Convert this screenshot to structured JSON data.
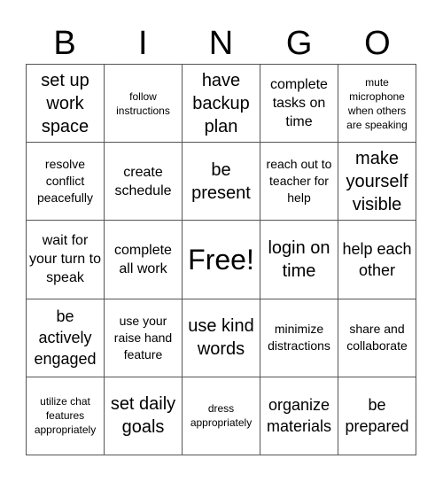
{
  "header": {
    "letters": [
      "B",
      "I",
      "N",
      "G",
      "O"
    ]
  },
  "card": {
    "rows": [
      [
        {
          "text": "set up work space",
          "size": "xl"
        },
        {
          "text": "follow instructions",
          "size": "xs"
        },
        {
          "text": "have backup plan",
          "size": "xl"
        },
        {
          "text": "complete tasks on time",
          "size": "md"
        },
        {
          "text": "mute microphone when others are speaking",
          "size": "xs"
        }
      ],
      [
        {
          "text": "resolve conflict peacefully",
          "size": "sm"
        },
        {
          "text": "create schedule",
          "size": "md"
        },
        {
          "text": "be present",
          "size": "xl"
        },
        {
          "text": "reach out to teacher for help",
          "size": "sm"
        },
        {
          "text": "make yourself visible",
          "size": "xl"
        }
      ],
      [
        {
          "text": "wait for your turn to speak",
          "size": "md"
        },
        {
          "text": "complete all work",
          "size": "md"
        },
        {
          "text": "Free!",
          "size": "free"
        },
        {
          "text": "login on time",
          "size": "xl"
        },
        {
          "text": "help each other",
          "size": "lg"
        }
      ],
      [
        {
          "text": "be actively engaged",
          "size": "lg"
        },
        {
          "text": "use your raise hand feature",
          "size": "sm"
        },
        {
          "text": "use kind words",
          "size": "xl"
        },
        {
          "text": "minimize distractions",
          "size": "sm"
        },
        {
          "text": "share and collaborate",
          "size": "sm"
        }
      ],
      [
        {
          "text": "utilize chat features appropriately",
          "size": "xs"
        },
        {
          "text": "set daily goals",
          "size": "xl"
        },
        {
          "text": "dress appropriately",
          "size": "xs"
        },
        {
          "text": "organize materials",
          "size": "lg"
        },
        {
          "text": "be prepared",
          "size": "lg"
        }
      ]
    ]
  }
}
